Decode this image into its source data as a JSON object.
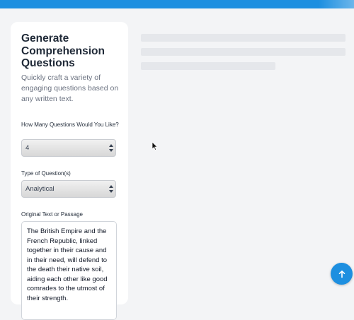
{
  "form": {
    "title": "Generate Comprehension Questions",
    "subtitle": "Quickly craft a variety of engaging questions based on any written text.",
    "count_label": "How Many Questions Would You Like?",
    "count_value": "4",
    "type_label": "Type of Question(s)",
    "type_value": "Analytical",
    "text_label": "Original Text or Passage",
    "text_value": "The British Empire and the French Republic, linked together in their cause and in their need, will defend to the death their native soil, aiding each other like good comrades to the utmost of their strength."
  },
  "icons": {
    "select_arrows": "updown-arrows-icon",
    "scroll_top": "arrow-up-icon",
    "cursor": "mouse-pointer-icon"
  },
  "colors": {
    "accent": "#1d8fe0",
    "background": "#f3f4f6",
    "card": "#ffffff",
    "skeleton": "#e5e7eb"
  }
}
